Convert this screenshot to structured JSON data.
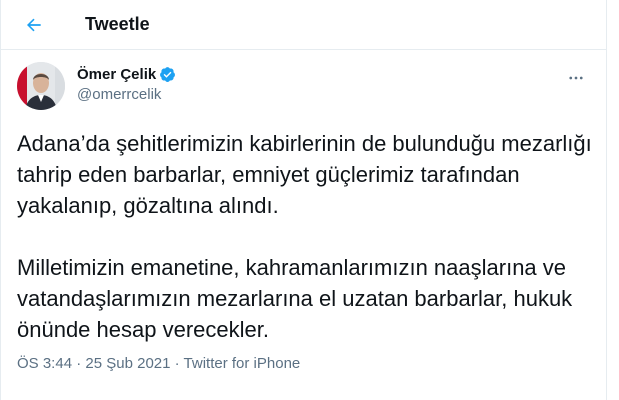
{
  "header": {
    "title": "Tweetle"
  },
  "author": {
    "display_name": "Ömer Çelik",
    "handle": "@omerrcelik",
    "verified": true
  },
  "tweet": {
    "paragraph_1": "Adana’da şehitlerimizin kabirlerinin de bulunduğu mezarlığı tahrip eden barbarlar, emniyet güçlerimiz tarafından yakalanıp, gözaltına alındı.",
    "paragraph_2": "Milletimizin emanetine, kahramanlarımızın naaşlarına ve vatandaşlarımızın mezarlarına el uzatan barbarlar, hukuk önünde hesap verecekler."
  },
  "meta": {
    "time": "ÖS 3:44",
    "separator_1": " · ",
    "date": "25 Şub 2021",
    "separator_2": " · ",
    "source": "Twitter for iPhone"
  },
  "icons": {
    "back": "arrow-left-icon",
    "verified": "verified-badge-icon",
    "more": "more-horizontal-icon"
  },
  "colors": {
    "accent": "#1da1f2",
    "text": "#0f1419",
    "secondary_text": "#5b7083",
    "border": "#e6ecf0"
  }
}
